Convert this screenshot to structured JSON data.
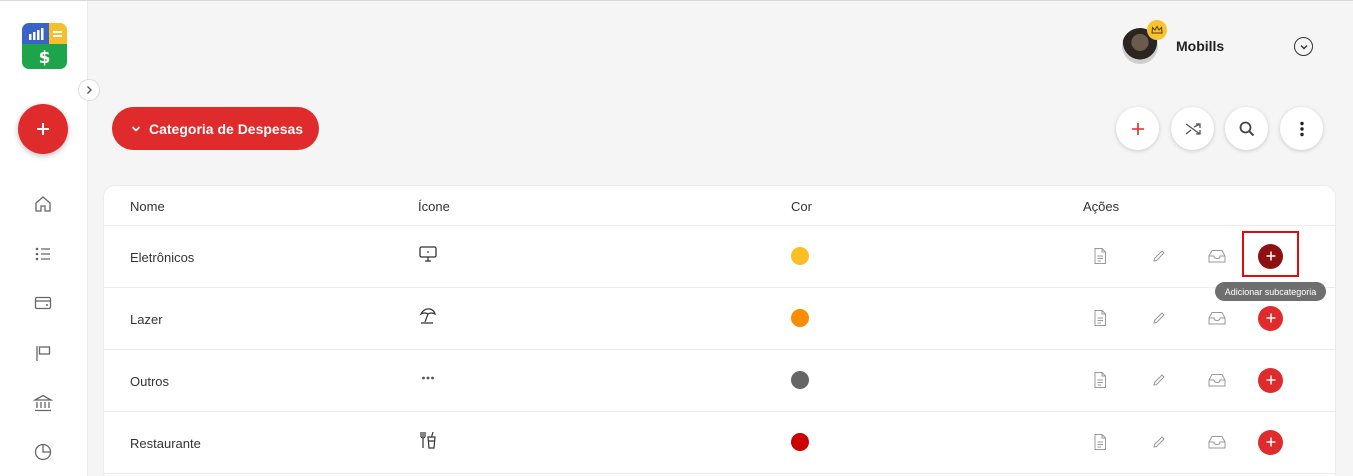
{
  "app": {
    "name": "Mobills",
    "accent": "#df2b2b"
  },
  "sidebar": {
    "logo": "mobills-logo",
    "collapse_icon": "chevron-right-icon",
    "fab_icon": "plus-icon",
    "nav": [
      "home-icon",
      "list-icon",
      "wallet-icon",
      "flag-icon",
      "bank-icon",
      "pie-chart-icon"
    ]
  },
  "header": {
    "user_name": "Mobills",
    "badge_icon": "crown-icon",
    "dropdown_icon": "chevron-down-icon"
  },
  "toolbar": {
    "category_label": "Categoria de Despesas",
    "actions": [
      "plus-icon",
      "shuffle-icon",
      "search-icon",
      "more-vertical-icon"
    ]
  },
  "table": {
    "columns": {
      "name": "Nome",
      "icon": "Ícone",
      "color": "Cor",
      "actions": "Ações"
    },
    "rows": [
      {
        "name": "Eletrônicos",
        "icon": "monitor-icon",
        "color": "#fbbf24"
      },
      {
        "name": "Lazer",
        "icon": "umbrella-beach-icon",
        "color": "#fb8c00"
      },
      {
        "name": "Outros",
        "icon": "dots-icon",
        "color": "#666666"
      },
      {
        "name": "Restaurante",
        "icon": "food-drink-icon",
        "color": "#cc0000"
      }
    ],
    "row_actions": [
      "document-icon",
      "pencil-icon",
      "archive-icon",
      "add-subcategory-icon"
    ]
  },
  "tooltip": {
    "text": "Adicionar subcategoria"
  }
}
